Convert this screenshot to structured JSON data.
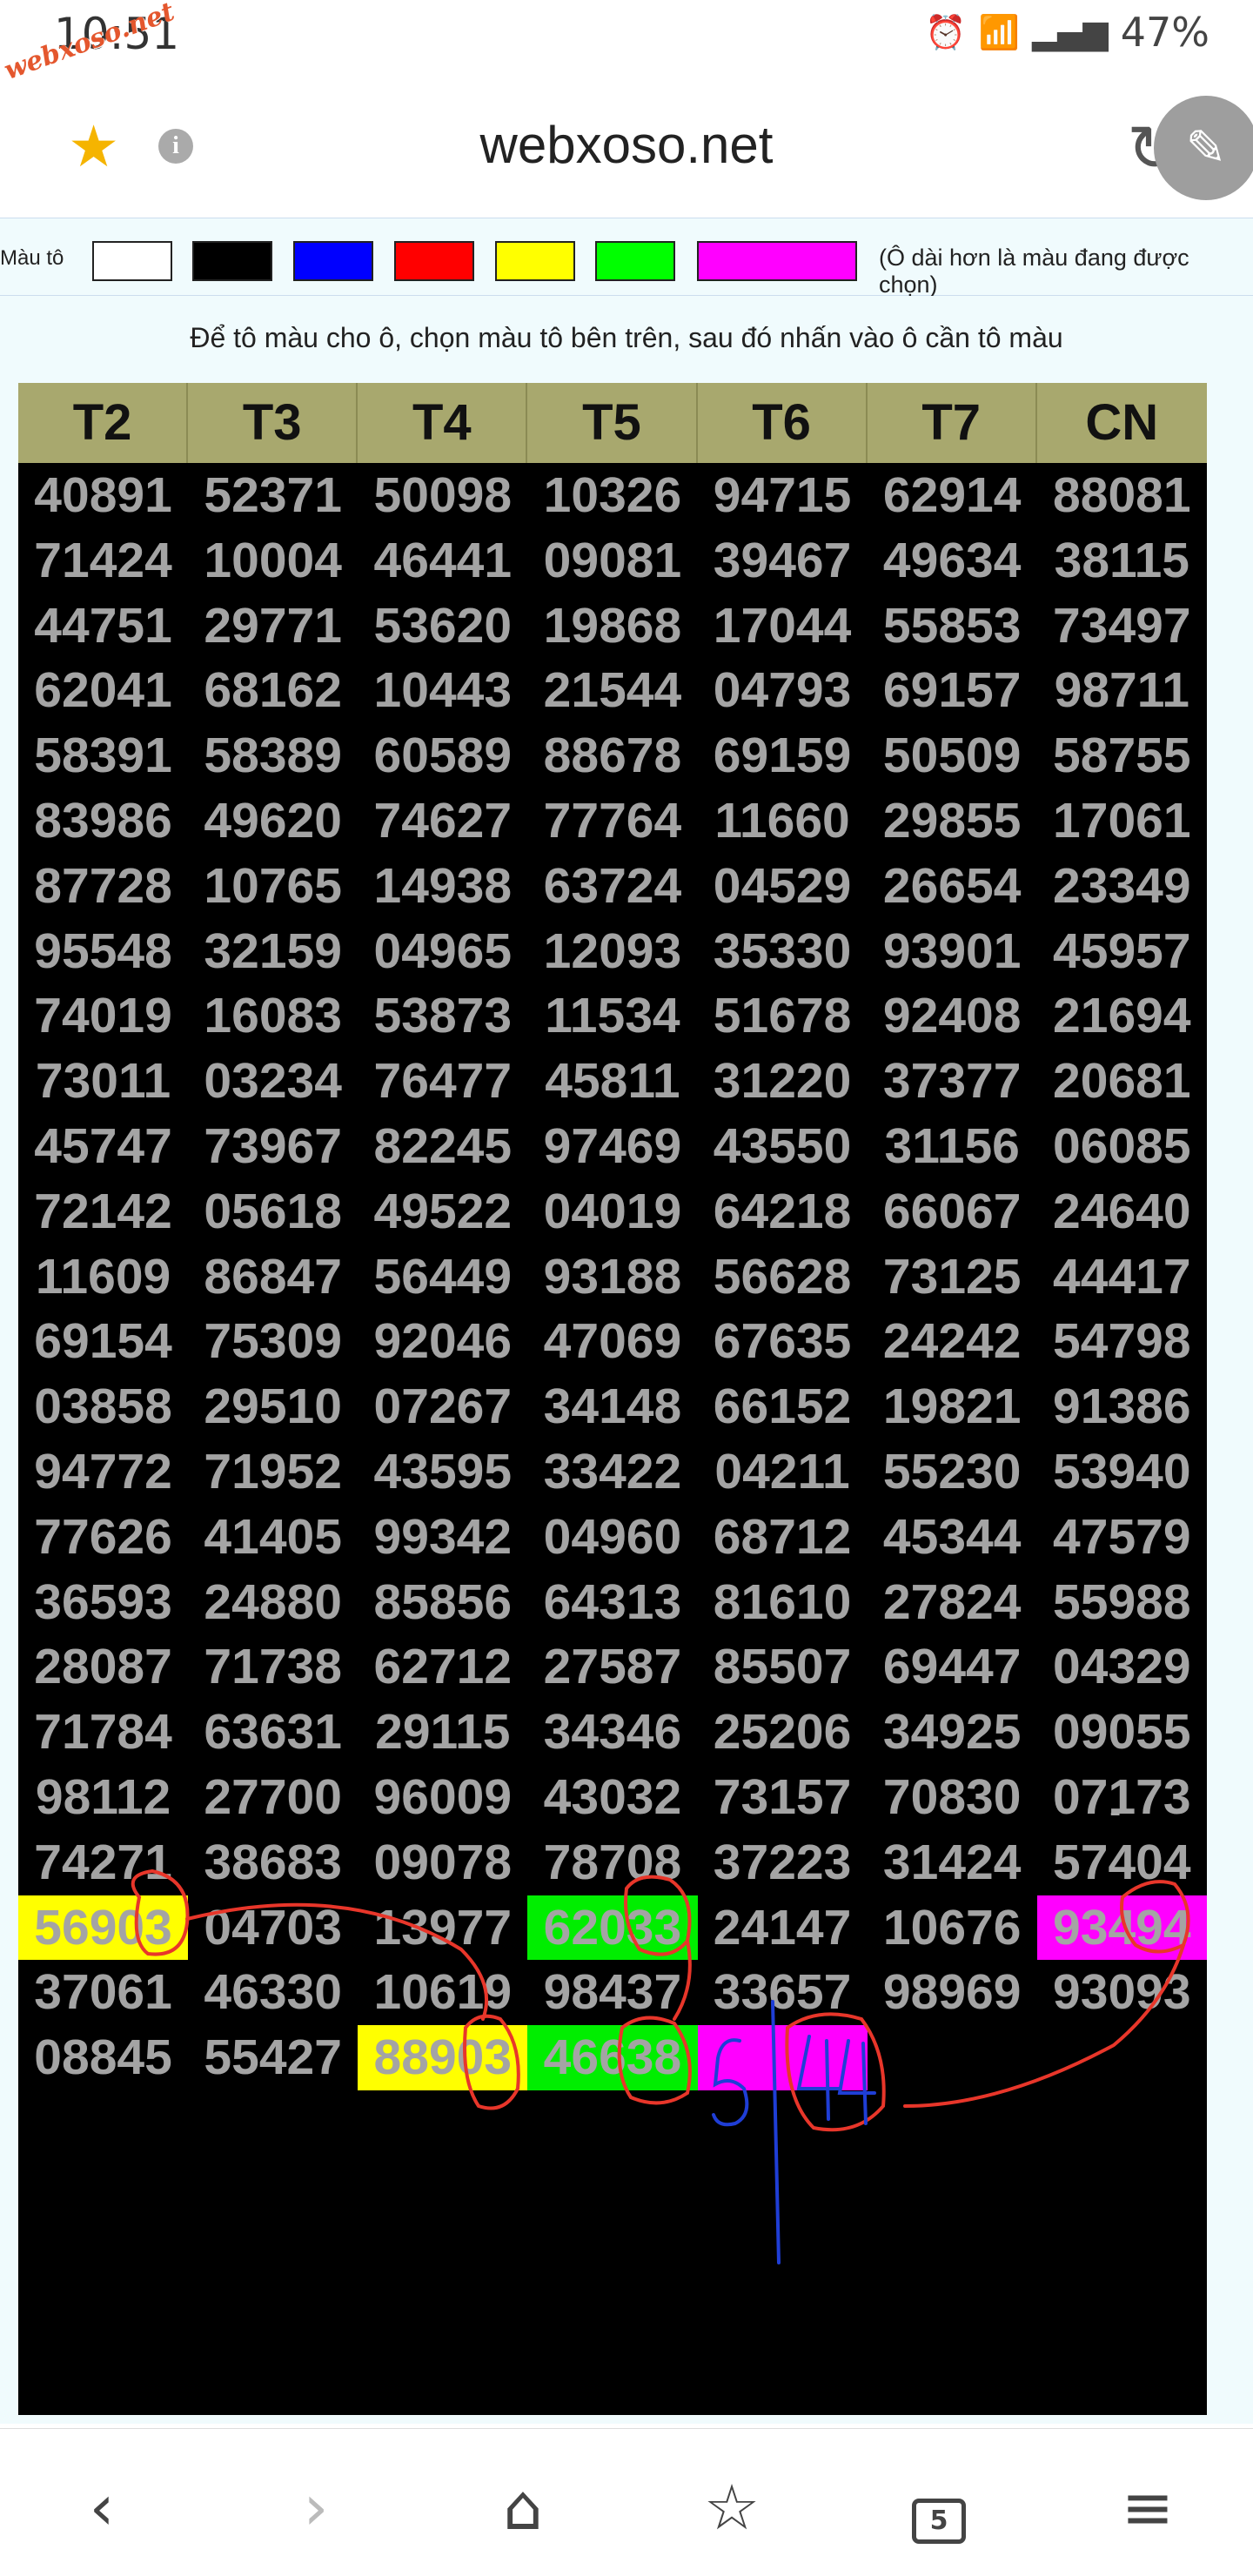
{
  "status_bar": {
    "time": "10:51",
    "watermark": "webxoso.net",
    "battery": "47%",
    "icons": [
      "alarm-icon",
      "wifi-icon",
      "signal-icon",
      "signal-icon",
      "battery-icon"
    ]
  },
  "browser": {
    "url": "webxoso.net",
    "icons": [
      "star-icon",
      "info-icon",
      "reload-icon",
      "edit-icon"
    ]
  },
  "palette": {
    "label": "Màu tô",
    "swatches": [
      "#ffffff",
      "#000000",
      "#0000ff",
      "#ff0000",
      "#ffff00",
      "#00ff00",
      "#ff00ff"
    ],
    "selected": "#ff00ff",
    "note": "(Ô dài hơn là màu đang được chọn)"
  },
  "instruction": "Để tô màu cho ô, chọn màu tô bên trên, sau đó nhấn vào ô cần tô màu",
  "table": {
    "headers": [
      "T2",
      "T3",
      "T4",
      "T5",
      "T6",
      "T7",
      "CN"
    ],
    "rows": [
      [
        "40891",
        "52371",
        "50098",
        "10326",
        "94715",
        "62914",
        "88081"
      ],
      [
        "71424",
        "10004",
        "46441",
        "09081",
        "39467",
        "49634",
        "38115"
      ],
      [
        "44751",
        "29771",
        "53620",
        "19868",
        "17044",
        "55853",
        "73497"
      ],
      [
        "62041",
        "68162",
        "10443",
        "21544",
        "04793",
        "69157",
        "98711"
      ],
      [
        "58391",
        "58389",
        "60589",
        "88678",
        "69159",
        "50509",
        "58755"
      ],
      [
        "83986",
        "49620",
        "74627",
        "77764",
        "11660",
        "29855",
        "17061"
      ],
      [
        "87728",
        "10765",
        "14938",
        "63724",
        "04529",
        "26654",
        "23349"
      ],
      [
        "95548",
        "32159",
        "04965",
        "12093",
        "35330",
        "93901",
        "45957"
      ],
      [
        "74019",
        "16083",
        "53873",
        "11534",
        "51678",
        "92408",
        "21694"
      ],
      [
        "73011",
        "03234",
        "76477",
        "45811",
        "31220",
        "37377",
        "20681"
      ],
      [
        "45747",
        "73967",
        "82245",
        "97469",
        "43550",
        "31156",
        "06085"
      ],
      [
        "72142",
        "05618",
        "49522",
        "04019",
        "64218",
        "66067",
        "24640"
      ],
      [
        "11609",
        "86847",
        "56449",
        "93188",
        "56628",
        "73125",
        "44417"
      ],
      [
        "69154",
        "75309",
        "92046",
        "47069",
        "67635",
        "24242",
        "54798"
      ],
      [
        "03858",
        "29510",
        "07267",
        "34148",
        "66152",
        "19821",
        "91386"
      ],
      [
        "94772",
        "71952",
        "43595",
        "33422",
        "04211",
        "55230",
        "53940"
      ],
      [
        "77626",
        "41405",
        "99342",
        "04960",
        "68712",
        "45344",
        "47579"
      ],
      [
        "36593",
        "24880",
        "85856",
        "64313",
        "81610",
        "27824",
        "55988"
      ],
      [
        "28087",
        "71738",
        "62712",
        "27587",
        "85507",
        "69447",
        "04329"
      ],
      [
        "71784",
        "63631",
        "29115",
        "34346",
        "25206",
        "34925",
        "09055"
      ],
      [
        "98112",
        "27700",
        "96009",
        "43032",
        "73157",
        "70830",
        "07173"
      ],
      [
        "74271",
        "38683",
        "09078",
        "78708",
        "37223",
        "31424",
        "57404"
      ],
      [
        "56903",
        "04703",
        "13977",
        "62033",
        "24147",
        "10676",
        "93494"
      ],
      [
        "37061",
        "46330",
        "10619",
        "98437",
        "33657",
        "98969",
        "93093"
      ],
      [
        "08845",
        "55427",
        "88903",
        "46638",
        "",
        "",
        ""
      ]
    ],
    "highlights": [
      {
        "row": 22,
        "col": 0,
        "color": "yellow"
      },
      {
        "row": 22,
        "col": 3,
        "color": "green"
      },
      {
        "row": 22,
        "col": 6,
        "color": "magenta"
      },
      {
        "row": 24,
        "col": 2,
        "color": "yellow"
      },
      {
        "row": 24,
        "col": 3,
        "color": "green"
      },
      {
        "row": 24,
        "col": 4,
        "color": "magenta"
      }
    ],
    "handwritten_note": "5 | 44",
    "dash": "-"
  },
  "nav": {
    "tab_count": "5",
    "icons": [
      "back-icon",
      "forward-icon",
      "home-icon",
      "bookmarks-icon",
      "tabs-icon",
      "menu-icon"
    ]
  }
}
